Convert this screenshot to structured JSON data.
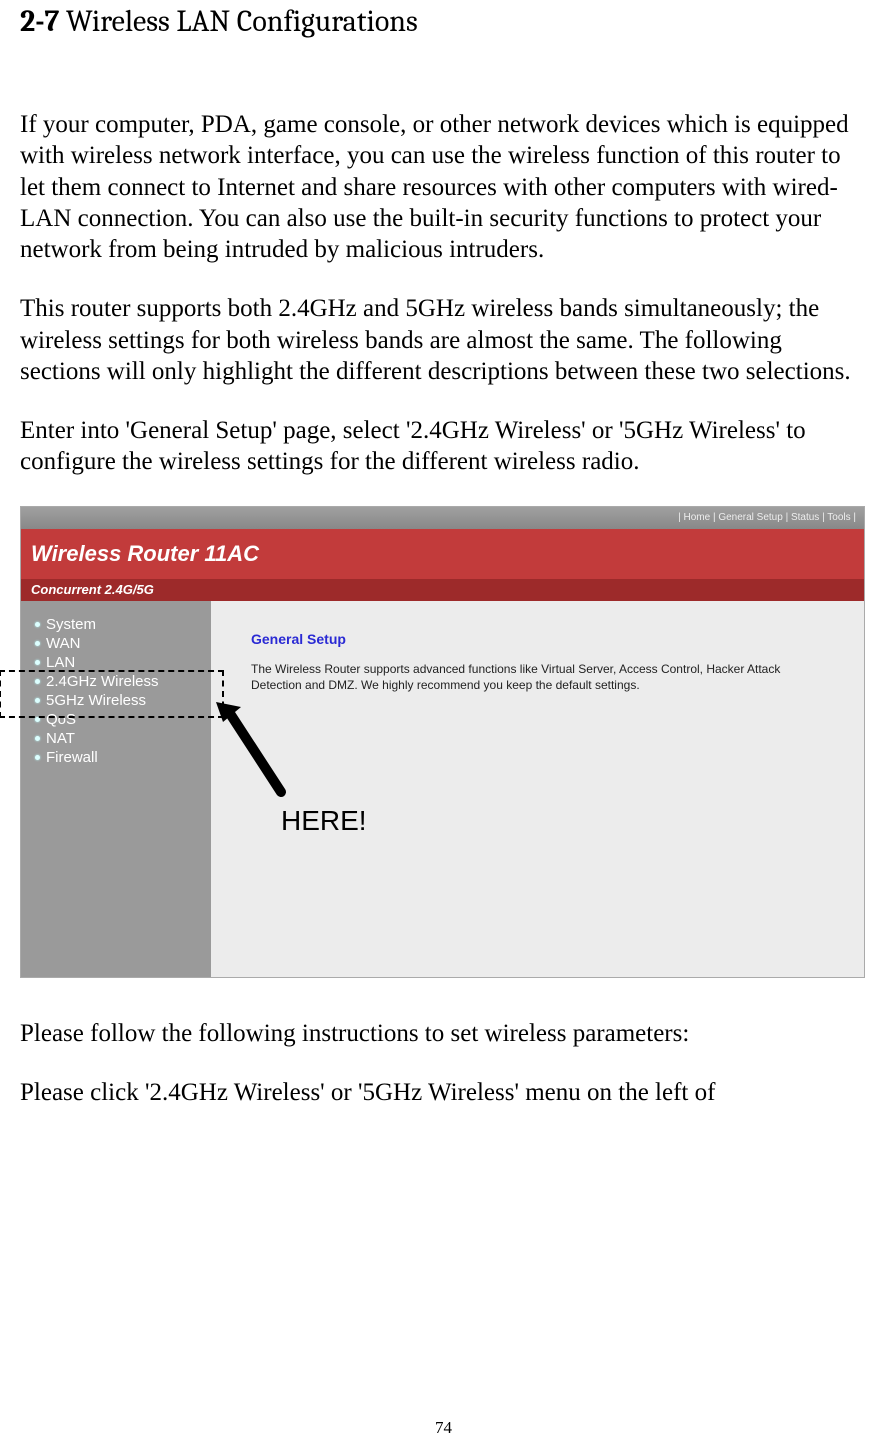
{
  "section": {
    "number": "2-7",
    "title": "Wireless LAN Configurations"
  },
  "paragraphs": {
    "p1": "If your computer, PDA, game console, or other network devices which is equipped with wireless network interface, you can use the wireless function of this router to let them connect to Internet and share resources with other computers with wired-LAN connection. You can also use the built-in security functions to protect your network from being intruded by malicious intruders.",
    "p2": "This router supports both 2.4GHz and 5GHz wireless bands simultaneously; the wireless settings for both wireless bands are almost the same. The following sections will only highlight the different descriptions between these two selections.",
    "p3": "Enter into 'General Setup' page, select '2.4GHz Wireless' or '5GHz Wireless' to configure the wireless settings for the different wireless radio.",
    "p4": "Please follow the following instructions to set wireless parameters:",
    "p5": "Please click '2.4GHz Wireless' or '5GHz Wireless' menu on the left of"
  },
  "router_ui": {
    "top_nav": "| Home | General Setup | Status | Tools |",
    "brand_title": "Wireless Router 11AC",
    "brand_sub": "Concurrent 2.4G/5G",
    "sidebar": {
      "items": [
        {
          "label": "System"
        },
        {
          "label": "WAN"
        },
        {
          "label": "LAN"
        },
        {
          "label": "2.4GHz Wireless"
        },
        {
          "label": "5GHz Wireless"
        },
        {
          "label": "QoS"
        },
        {
          "label": "NAT"
        },
        {
          "label": "Firewall"
        }
      ]
    },
    "content": {
      "header": "General Setup",
      "description": "The Wireless Router supports advanced functions like Virtual Server, Access Control, Hacker Attack Detection and DMZ. We highly recommend you keep the default settings."
    }
  },
  "annotation": {
    "here": "HERE!"
  },
  "page_number": "74"
}
